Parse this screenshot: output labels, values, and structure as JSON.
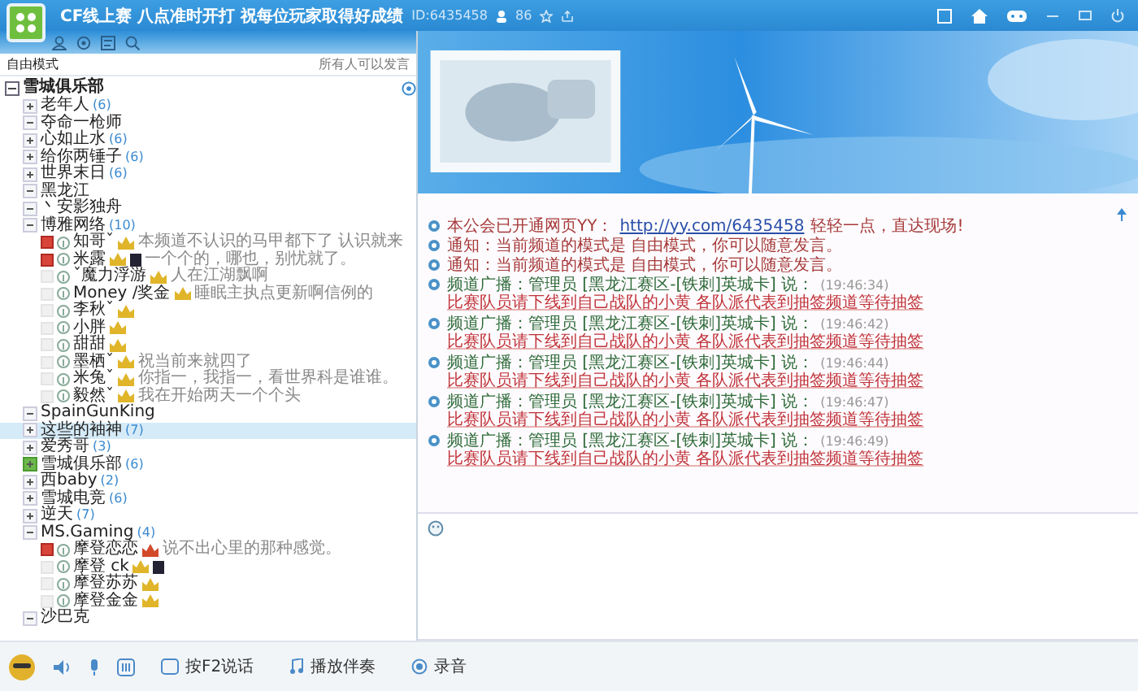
{
  "title_bar": {
    "title": "CF线上赛 八点准时开打 祝每位玩家取得好成绩",
    "channel_id": "ID:6435458",
    "online_count": "86"
  },
  "channel_panel": {
    "mode": "自由模式",
    "speak_rule": "所有人可以发言"
  },
  "channel_tree": [
    {
      "kind": "root",
      "name": "雪城俱乐部",
      "selected": false,
      "expanded": true,
      "children": [
        {
          "kind": "channel",
          "name": "老年人",
          "count": "(6)",
          "selected": false,
          "expanded": false
        },
        {
          "kind": "channel",
          "name": "夺命一枪师",
          "selected": false,
          "expanded": true
        },
        {
          "kind": "channel",
          "name": "心如止水",
          "count": "(6)",
          "selected": false,
          "expanded": false
        },
        {
          "kind": "channel",
          "name": "给你两锤子",
          "count": "(6)",
          "selected": false,
          "expanded": false
        },
        {
          "kind": "channel",
          "name": "世界末日",
          "count": "(6)",
          "selected": false,
          "expanded": false
        },
        {
          "kind": "channel",
          "name": "黑龙江",
          "selected": false,
          "expanded": true
        },
        {
          "kind": "channel",
          "name": "丶安影独舟",
          "selected": false,
          "expanded": true
        },
        {
          "kind": "channel",
          "name": "博雅网络",
          "count": "(10)",
          "selected": false,
          "expanded": true,
          "children": [
            {
              "kind": "user",
              "name": "知哥ˇ",
              "status": "本频道不认识的马甲都下了 认识就来",
              "muted": true,
              "color": "#e0b52a",
              "selected": false
            },
            {
              "kind": "user",
              "name": "米露",
              "status": "一个个的，哪也，别忧就了。",
              "muted": true,
              "color": "#e0b52a",
              "vip": true,
              "selected": false
            },
            {
              "kind": "user",
              "name": "ˇ魔力浮游",
              "status": "人在江湖飘啊",
              "muted": false,
              "color": "#e0b52a",
              "selected": false
            },
            {
              "kind": "user",
              "name": "Money /奖金",
              "status": "睡眠主执点更新啊信例的",
              "muted": false,
              "color": "#e0b52a",
              "selected": false
            },
            {
              "kind": "user",
              "name": "李秋ˇ",
              "muted": false,
              "color": "#e0b52a",
              "selected": false
            },
            {
              "kind": "user",
              "name": "小胖",
              "muted": false,
              "color": "#e0b52a",
              "selected": false
            },
            {
              "kind": "user",
              "name": "甜甜",
              "muted": false,
              "color": "#e0b52a",
              "selected": false
            },
            {
              "kind": "user",
              "name": "墨栖ˇ",
              "status": "祝当前来就四了",
              "muted": false,
              "color": "#e0b52a",
              "selected": false
            },
            {
              "kind": "user",
              "name": "米兔ˇ",
              "status": "你指一，我指一，看世界科是谁谁。",
              "muted": false,
              "color": "#e0b52a",
              "selected": false
            },
            {
              "kind": "user",
              "name": "毅然ˇ",
              "status": "我在开始两天一个个头",
              "muted": false,
              "color": "#e0b52a",
              "selected": false
            }
          ]
        },
        {
          "kind": "channel",
          "name": "SpainGunKing",
          "selected": false,
          "expanded": true
        },
        {
          "kind": "channel",
          "name": "这些的袖神",
          "count": "(7)",
          "selected": true,
          "expanded": false
        },
        {
          "kind": "channel",
          "name": "爱秀哥",
          "count": "(3)",
          "selected": false,
          "expanded": false
        },
        {
          "kind": "channel",
          "name": "雪城俱乐部",
          "count": "(6)",
          "selected": false,
          "expanded": false,
          "locked": true
        },
        {
          "kind": "channel",
          "name": "西baby",
          "count": "(2)",
          "selected": false,
          "expanded": false
        },
        {
          "kind": "channel",
          "name": "雪城电竞",
          "count": "(6)",
          "selected": false,
          "expanded": false
        },
        {
          "kind": "channel",
          "name": "逆天",
          "count": "(7)",
          "selected": false,
          "expanded": false
        },
        {
          "kind": "channel",
          "name": "MS.Gaming",
          "count": "(4)",
          "selected": false,
          "expanded": true,
          "children": [
            {
              "kind": "user",
              "name": "摩登恋恋",
              "status": "说不出心里的那种感觉。",
              "muted": true,
              "color": "#d24a2a",
              "selected": false
            },
            {
              "kind": "user",
              "name": "摩登 ck",
              "muted": false,
              "color": "#e0b52a",
              "vip": true,
              "selected": false
            },
            {
              "kind": "user",
              "name": "摩登苏苏",
              "muted": false,
              "color": "#e0b52a",
              "selected": false
            },
            {
              "kind": "user",
              "name": "摩登金金",
              "muted": false,
              "color": "#e0b52a",
              "selected": false
            }
          ]
        },
        {
          "kind": "channel",
          "name": "沙巴克",
          "selected": false,
          "expanded": true
        }
      ]
    }
  ],
  "chat_messages": [
    {
      "kind": "link",
      "text": "本公会已开通网页YY：",
      "link": "http://yy.com/6435458",
      "tail": "轻轻一点，直达现场!"
    },
    {
      "kind": "notice",
      "text": "通知：当前频道的模式是 自由模式，你可以随意发言。"
    },
    {
      "kind": "notice",
      "text": "通知：当前频道的模式是 自由模式，你可以随意发言。"
    },
    {
      "kind": "broadcast",
      "text": "频道广播：管理员 [黑龙江赛区-[铁刺]英城卡] 说：",
      "time": "(19:46:34)",
      "body": "比赛队员请下线到自己战队的小黄 各队派代表到抽签频道等待抽签"
    },
    {
      "kind": "broadcast",
      "text": "频道广播：管理员 [黑龙江赛区-[铁刺]英城卡] 说：",
      "time": "(19:46:42)",
      "body": "比赛队员请下线到自己战队的小黄 各队派代表到抽签频道等待抽签"
    },
    {
      "kind": "broadcast",
      "text": "频道广播：管理员 [黑龙江赛区-[铁刺]英城卡] 说：",
      "time": "(19:46:44)",
      "body": "比赛队员请下线到自己战队的小黄 各队派代表到抽签频道等待抽签"
    },
    {
      "kind": "broadcast",
      "text": "频道广播：管理员 [黑龙江赛区-[铁刺]英城卡] 说：",
      "time": "(19:46:47)",
      "body": "比赛队员请下线到自己战队的小黄 各队派代表到抽签频道等待抽签"
    },
    {
      "kind": "broadcast",
      "text": "频道广播：管理员 [黑龙江赛区-[铁刺]英城卡] 说：",
      "time": "(19:46:49)",
      "body": "比赛队员请下线到自己战队的小黄 各队派代表到抽签频道等待抽签"
    }
  ],
  "bottom_bar": {
    "talk_button": "按F2说话",
    "accompaniment_button": "播放伴奏",
    "record_button": "录音"
  }
}
